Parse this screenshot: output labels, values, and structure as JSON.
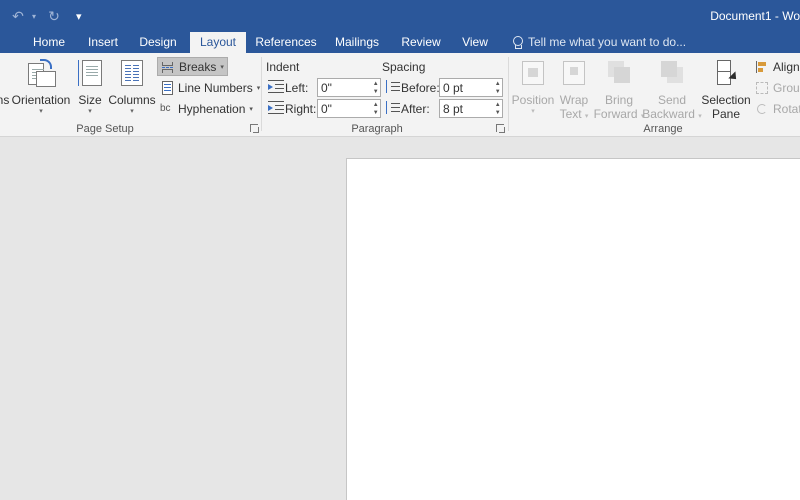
{
  "window": {
    "doc_title": "Document1 - Wo",
    "qat": {
      "undo_icon": "undo-icon",
      "redo_icon": "redo-icon",
      "customize_icon": "customize-qat-icon"
    }
  },
  "tabs": [
    {
      "label": "Home"
    },
    {
      "label": "Insert"
    },
    {
      "label": "Design"
    },
    {
      "label": "Layout",
      "active": true
    },
    {
      "label": "References"
    },
    {
      "label": "Mailings"
    },
    {
      "label": "Review"
    },
    {
      "label": "View"
    }
  ],
  "tell_me": {
    "label": "Tell me what you want to do..."
  },
  "ribbon": {
    "page_setup": {
      "label": "Page Setup",
      "margins_label": "ns",
      "orientation_label": "Orientation",
      "size_label": "Size",
      "columns_label": "Columns",
      "breaks_label": "Breaks",
      "line_numbers_label": "Line Numbers",
      "hyphenation_label": "Hyphenation"
    },
    "paragraph": {
      "label": "Paragraph",
      "indent_heading": "Indent",
      "spacing_heading": "Spacing",
      "left_label": "Left:",
      "right_label": "Right:",
      "before_label": "Before:",
      "after_label": "After:",
      "indent_left": "0\"",
      "indent_right": "0\"",
      "spacing_before": "0 pt",
      "spacing_after": "8 pt"
    },
    "arrange": {
      "label": "Arrange",
      "position_label": "Position",
      "wrap_text_line1": "Wrap",
      "wrap_text_line2": "Text",
      "bring_forward_line1": "Bring",
      "bring_forward_line2": "Forward",
      "send_backward_line1": "Send",
      "send_backward_line2": "Backward",
      "selection_pane_line1": "Selection",
      "selection_pane_line2": "Pane",
      "align_label": "Align",
      "group_label": "Group",
      "rotate_label": "Rotate"
    }
  },
  "colors": {
    "accent": "#2b579a",
    "ribbon_bg": "#f3f3f3",
    "workspace_bg": "#e6e6e6"
  }
}
